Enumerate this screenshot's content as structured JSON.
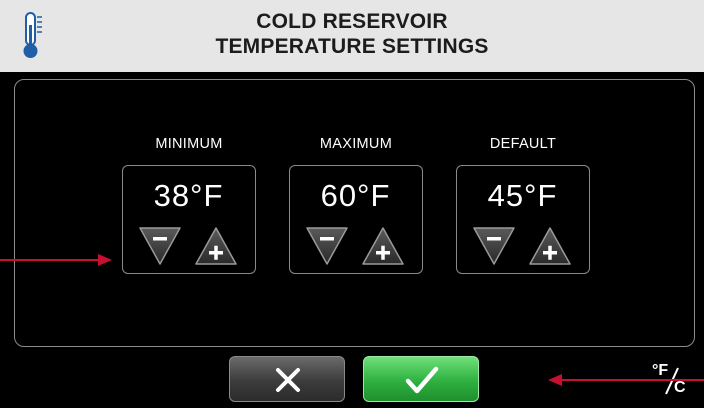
{
  "header": {
    "title_line1": "COLD RESERVOIR",
    "title_line2": "TEMPERATURE SETTINGS",
    "icon": "thermometer-icon"
  },
  "settings": [
    {
      "label": "MINIMUM",
      "value": "38°F"
    },
    {
      "label": "MAXIMUM",
      "value": "60°F"
    },
    {
      "label": "DEFAULT",
      "value": "45°F"
    }
  ],
  "buttons": {
    "cancel_icon": "close-icon",
    "confirm_icon": "check-icon"
  },
  "unit_toggle": {
    "fahrenheit": "°F",
    "celsius": "C"
  },
  "colors": {
    "header_bg": "#e6e6e6",
    "screen_bg": "#000000",
    "confirm_green": "#2fb03f",
    "callout_red": "#c8102e"
  }
}
